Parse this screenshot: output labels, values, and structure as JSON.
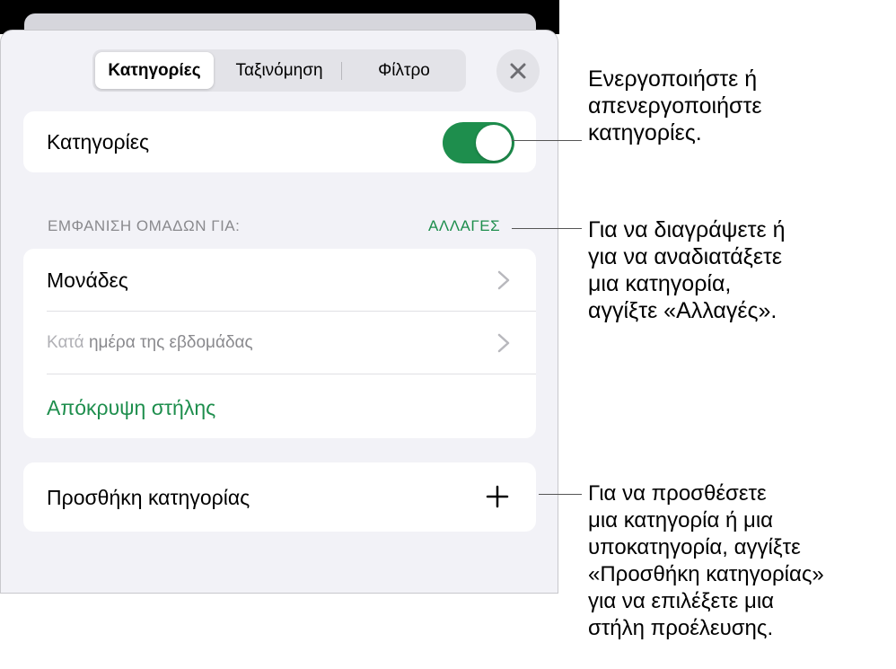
{
  "segmented": {
    "categories": "Κατηγορίες",
    "sort": "Ταξινόμηση",
    "filter": "Φίλτρο"
  },
  "categories_row": {
    "label": "Κατηγορίες",
    "toggle_on": true
  },
  "groups_section": {
    "header": "ΕΜΦΑΝΙΣΗ ΟΜΑΔΩΝ ΓΙΑ:",
    "edit": "ΑΛΛΑΓΕΣ",
    "items": [
      {
        "label": "Μονάδες"
      },
      {
        "prefix": "Κατά",
        "label": "ημέρα της εβδομάδας"
      }
    ],
    "hide_column": "Απόκρυψη στήλης"
  },
  "add_category": {
    "label": "Προσθήκη κατηγορίας"
  },
  "callouts": {
    "toggle": [
      "Ενεργοποιήστε ή",
      "απενεργοποιήστε",
      "κατηγορίες."
    ],
    "edit": [
      "Για να διαγράψετε ή",
      "για να αναδιατάξετε",
      "μια κατηγορία,",
      "αγγίξτε «Αλλαγές»."
    ],
    "add": [
      "Για να προσθέσετε",
      "μια κατηγορία ή μια",
      "υποκατηγορία, αγγίξτε",
      "«Προσθήκη κατηγορίας»",
      "για να επιλέξετε μια",
      "στήλη προέλευσης."
    ]
  },
  "colors": {
    "accent": "#1e8e4d",
    "panel_bg": "#f2f2f7",
    "secondary_text": "#8a8a8e"
  }
}
